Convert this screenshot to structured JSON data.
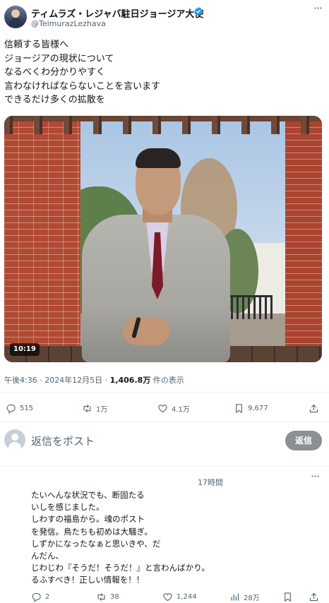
{
  "post": {
    "author_name": "ティムラズ・レジャバ駐日ジョージア大使",
    "author_handle": "@TeimurazLezhava",
    "text_lines": [
      "信頼する皆様へ",
      "ジョージアの現状について",
      "なるべくわ分かりやすく",
      "言わなければならないことを言います",
      "できるだけ多くの拡散を"
    ],
    "video_duration": "10:19",
    "timestamp": "午後4:36 · 2024年12月5日 · ",
    "views_count": "1,406.8万",
    "views_label": " 件の表示",
    "actions": {
      "replies": "515",
      "reposts": "1万",
      "likes": "4.1万",
      "bookmarks": "9,677"
    }
  },
  "reply_composer": {
    "placeholder": "返信をポスト",
    "button_label": "返信"
  },
  "reply": {
    "time": "17時間",
    "text_lines": [
      "たいへんな状況でも、断固たる",
      "いしを感じました。",
      "しわすの福島から。魂のポスト",
      "を発信。鳥たちも初めは大騒ぎ。",
      "しずかになったなぁと思いきや、だ",
      "んだん、",
      "じわじわ『そうだ！そうだ！』と言わんばかり。",
      "るふすべき！正しい情報を！！"
    ],
    "actions": {
      "replies": "2",
      "reposts": "38",
      "likes": "1,244",
      "views": "28万"
    }
  },
  "colors": {
    "verified": "#1d9bf0",
    "secondary_text": "#536471",
    "reply_button_bg": "#8b9094"
  },
  "icons": [
    "verified-badge-icon",
    "more-icon",
    "reply-icon",
    "repost-icon",
    "like-icon",
    "bookmark-icon",
    "share-icon",
    "views-icon"
  ]
}
